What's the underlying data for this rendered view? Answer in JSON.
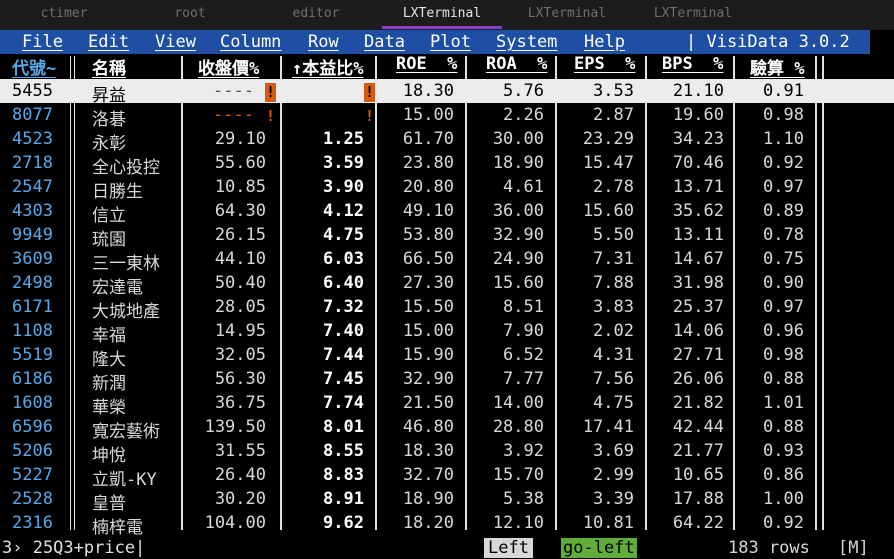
{
  "tabs": [
    {
      "label": "ctimer"
    },
    {
      "label": "root"
    },
    {
      "label": "editor"
    },
    {
      "label": "LXTerminal"
    },
    {
      "label": "LXTerminal"
    },
    {
      "label": "LXTerminal"
    }
  ],
  "menu": {
    "items": [
      "File",
      "Edit",
      "View",
      "Column",
      "Row",
      "Data",
      "Plot",
      "System",
      "Help"
    ],
    "app_title": "| VisiData 3.0.2"
  },
  "columns": {
    "code": "代號~",
    "name": "名稱",
    "price": "收盤價%",
    "ratio": "↑本益比%",
    "roe": "ROE  %",
    "roa": "ROA  %",
    "eps": "EPS  %",
    "bps": "BPS  %",
    "acid": "驗算 %"
  },
  "rows": [
    {
      "code": "5455",
      "name": "昇益",
      "price": "----",
      "ratio": "",
      "roe": "18.30",
      "roa": "5.76",
      "eps": "3.53",
      "bps": "21.10",
      "acid": "0.91"
    },
    {
      "code": "8077",
      "name": "洛碁",
      "price": "----",
      "ratio": "",
      "roe": "15.00",
      "roa": "2.26",
      "eps": "2.87",
      "bps": "19.60",
      "acid": "0.98"
    },
    {
      "code": "4523",
      "name": "永彰",
      "price": "29.10",
      "ratio": "1.25",
      "roe": "61.70",
      "roa": "30.00",
      "eps": "23.29",
      "bps": "34.23",
      "acid": "1.10"
    },
    {
      "code": "2718",
      "name": "全心投控",
      "price": "55.60",
      "ratio": "3.59",
      "roe": "23.80",
      "roa": "18.90",
      "eps": "15.47",
      "bps": "70.46",
      "acid": "0.92"
    },
    {
      "code": "2547",
      "name": "日勝生",
      "price": "10.85",
      "ratio": "3.90",
      "roe": "20.80",
      "roa": "4.61",
      "eps": "2.78",
      "bps": "13.71",
      "acid": "0.97"
    },
    {
      "code": "4303",
      "name": "信立",
      "price": "64.30",
      "ratio": "4.12",
      "roe": "49.10",
      "roa": "36.00",
      "eps": "15.60",
      "bps": "35.62",
      "acid": "0.89"
    },
    {
      "code": "9949",
      "name": "琉園",
      "price": "26.15",
      "ratio": "4.75",
      "roe": "53.80",
      "roa": "32.90",
      "eps": "5.50",
      "bps": "13.11",
      "acid": "0.78"
    },
    {
      "code": "3609",
      "name": "三一東林",
      "price": "44.10",
      "ratio": "6.03",
      "roe": "66.50",
      "roa": "24.90",
      "eps": "7.31",
      "bps": "14.67",
      "acid": "0.75"
    },
    {
      "code": "2498",
      "name": "宏達電",
      "price": "50.40",
      "ratio": "6.40",
      "roe": "27.30",
      "roa": "15.60",
      "eps": "7.88",
      "bps": "31.98",
      "acid": "0.90"
    },
    {
      "code": "6171",
      "name": "大城地產",
      "price": "28.05",
      "ratio": "7.32",
      "roe": "15.50",
      "roa": "8.51",
      "eps": "3.83",
      "bps": "25.37",
      "acid": "0.97"
    },
    {
      "code": "1108",
      "name": "幸福",
      "price": "14.95",
      "ratio": "7.40",
      "roe": "15.00",
      "roa": "7.90",
      "eps": "2.02",
      "bps": "14.06",
      "acid": "0.96"
    },
    {
      "code": "5519",
      "name": "隆大",
      "price": "32.05",
      "ratio": "7.44",
      "roe": "15.90",
      "roa": "6.52",
      "eps": "4.31",
      "bps": "27.71",
      "acid": "0.98"
    },
    {
      "code": "6186",
      "name": "新潤",
      "price": "56.30",
      "ratio": "7.45",
      "roe": "32.90",
      "roa": "7.77",
      "eps": "7.56",
      "bps": "26.06",
      "acid": "0.88"
    },
    {
      "code": "1608",
      "name": "華榮",
      "price": "36.75",
      "ratio": "7.74",
      "roe": "21.50",
      "roa": "14.00",
      "eps": "4.75",
      "bps": "21.82",
      "acid": "1.01"
    },
    {
      "code": "6596",
      "name": "寬宏藝術",
      "price": "139.50",
      "ratio": "8.01",
      "roe": "46.80",
      "roa": "28.80",
      "eps": "17.41",
      "bps": "42.44",
      "acid": "0.88"
    },
    {
      "code": "5206",
      "name": "坤悅",
      "price": "31.55",
      "ratio": "8.55",
      "roe": "18.30",
      "roa": "3.92",
      "eps": "3.69",
      "bps": "21.77",
      "acid": "0.93"
    },
    {
      "code": "5227",
      "name": "立凱-KY",
      "price": "26.40",
      "ratio": "8.83",
      "roe": "32.70",
      "roa": "15.70",
      "eps": "2.99",
      "bps": "10.65",
      "acid": "0.86"
    },
    {
      "code": "2528",
      "name": "皇普",
      "price": "30.20",
      "ratio": "8.91",
      "roe": "18.90",
      "roa": "5.38",
      "eps": "3.39",
      "bps": "17.88",
      "acid": "1.00"
    },
    {
      "code": "2316",
      "name": "楠梓電",
      "price": "104.00",
      "ratio": "9.62",
      "roe": "18.20",
      "roa": "12.10",
      "eps": "10.81",
      "bps": "64.22",
      "acid": "0.92"
    }
  ],
  "status": {
    "sheet": "3› 25Q3+price|",
    "key": "Left",
    "command": "go-left",
    "row_count": "183 rows",
    "mode": "[M]",
    "command_bg": "#5fae3a"
  }
}
